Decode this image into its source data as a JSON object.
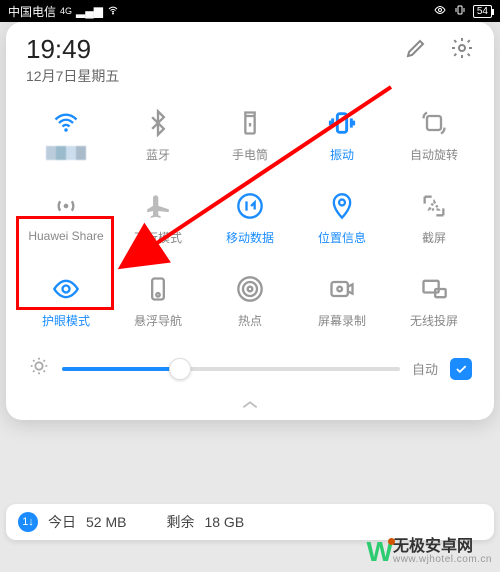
{
  "status": {
    "carrier": "中国电信",
    "net_badge": "4G",
    "battery": "54"
  },
  "header": {
    "time": "19:49",
    "date": "12月7日星期五"
  },
  "tiles": [
    {
      "key": "wifi",
      "label": "",
      "active": true
    },
    {
      "key": "bluetooth",
      "label": "蓝牙",
      "active": false
    },
    {
      "key": "flashlight",
      "label": "手电筒",
      "active": false
    },
    {
      "key": "vibrate",
      "label": "振动",
      "active": true
    },
    {
      "key": "autorotate",
      "label": "自动旋转",
      "active": false
    },
    {
      "key": "huaweishare",
      "label": "Huawei Share",
      "active": false
    },
    {
      "key": "airplane",
      "label": "飞行模式",
      "active": false
    },
    {
      "key": "mobiledata",
      "label": "移动数据",
      "active": true
    },
    {
      "key": "location",
      "label": "位置信息",
      "active": true
    },
    {
      "key": "screenshot",
      "label": "截屏",
      "active": false
    },
    {
      "key": "eyecare",
      "label": "护眼模式",
      "active": true
    },
    {
      "key": "floatnav",
      "label": "悬浮导航",
      "active": false
    },
    {
      "key": "hotspot",
      "label": "热点",
      "active": false
    },
    {
      "key": "screenrec",
      "label": "屏幕录制",
      "active": false
    },
    {
      "key": "cast",
      "label": "无线投屏",
      "active": false
    }
  ],
  "brightness": {
    "auto_label": "自动",
    "auto_on": true,
    "level_pct": 35
  },
  "datausage": {
    "today_label": "今日",
    "today_value": "52 MB",
    "remain_label": "剩余",
    "remain_value": "18 GB"
  },
  "watermark": {
    "name": "无极安卓网",
    "url": "www.wjhotel.com.cn"
  },
  "annotations": {
    "highlight_tile": "huaweishare",
    "arrow_from": "top-right",
    "arrow_to": "airplane"
  }
}
